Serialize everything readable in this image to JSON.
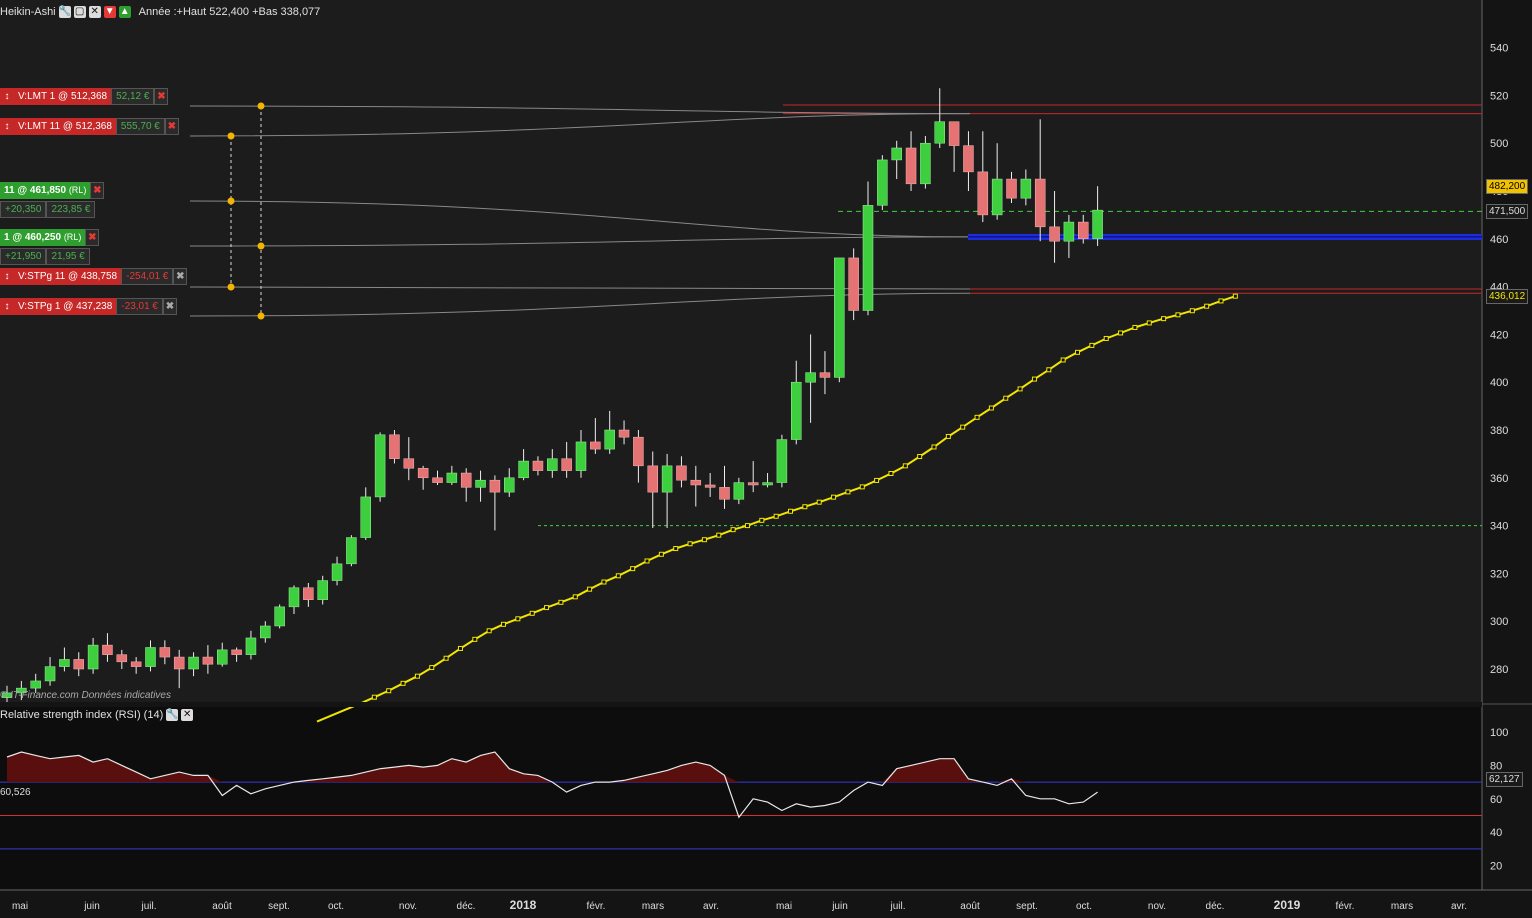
{
  "header": {
    "title": "Heikin-Ashi",
    "info": "Année :+Haut 522,400 +Bas 338,077",
    "copyright_prefix": "© IT-Finance.com",
    "copyright_suffix": "Données indicatives"
  },
  "rsi_header": {
    "title": "Relative strength index (RSI) (14)",
    "left_value": "60,526"
  },
  "orders": [
    {
      "label": "V:LMT  1 @ 512,368",
      "pnl": "52,12 €",
      "pnl_sign": "pos",
      "type": "red",
      "price": 515.5
    },
    {
      "label": "V:LMT  11 @ 512,368",
      "pnl": "555,70 €",
      "pnl_sign": "pos",
      "type": "red",
      "price": 503.5
    },
    {
      "label": "11 @ 461,850",
      "tag": "(RL)",
      "sub1": "+20,350",
      "sub2": "223,85 €",
      "type": "green",
      "price": 476
    },
    {
      "label": "1 @ 460,250",
      "tag": "(RL)",
      "sub1": "+21,950",
      "sub2": "21,95 €",
      "type": "green",
      "price": 456.5
    },
    {
      "label": "V:STPg  11 @ 438,758",
      "pnl": "-254,01 €",
      "pnl_sign": "neg",
      "type": "red",
      "price": 439.5
    },
    {
      "label": "V:STPg  1 @ 437,238",
      "pnl": "-23,01 €",
      "pnl_sign": "neg",
      "type": "red",
      "price": 429
    }
  ],
  "price_tags": [
    {
      "value": "482,200",
      "price": 482.2,
      "bg": "#f2c200",
      "fg": "#000"
    },
    {
      "value": "471,500",
      "price": 471.5,
      "bg": "#1a1a1a",
      "fg": "#ddd"
    },
    {
      "value": "436,012",
      "price": 436.0,
      "bg": "#1a1a1a",
      "fg": "#f2e600"
    }
  ],
  "rsi_tag": {
    "value": "62,127"
  },
  "colors": {
    "up": "#3ecf3e",
    "down": "#e57373",
    "ma": "#f2e600",
    "bg": "#1a1a1a",
    "grid_text": "#dddddd"
  },
  "chart_data": {
    "type": "candlestick",
    "title": "Heikin-Ashi",
    "y_axis": {
      "ticks": [
        280,
        300,
        320,
        340,
        360,
        380,
        400,
        420,
        440,
        460,
        480,
        500,
        520,
        540
      ]
    },
    "x_axis": {
      "ticks": [
        "mai",
        "juin",
        "juil.",
        "août",
        "sept.",
        "oct.",
        "nov.",
        "déc.",
        "2018",
        "févr.",
        "mars",
        "avr.",
        "mai",
        "juin",
        "juil.",
        "août",
        "sept.",
        "oct.",
        "nov.",
        "déc.",
        "2019",
        "févr.",
        "mars",
        "avr."
      ]
    },
    "candles": [
      [
        268,
        270,
        265,
        273
      ],
      [
        270,
        272,
        267,
        275
      ],
      [
        272,
        275,
        270,
        278
      ],
      [
        275,
        281,
        273,
        285
      ],
      [
        281,
        284,
        279,
        289
      ],
      [
        284,
        280,
        277,
        287
      ],
      [
        280,
        290,
        278,
        293
      ],
      [
        290,
        286,
        283,
        295
      ],
      [
        286,
        283,
        280,
        288
      ],
      [
        283,
        281,
        278,
        285
      ],
      [
        281,
        289,
        279,
        292
      ],
      [
        289,
        285,
        282,
        292
      ],
      [
        285,
        280,
        272,
        288
      ],
      [
        280,
        285,
        277,
        287
      ],
      [
        285,
        282,
        278,
        290
      ],
      [
        282,
        288,
        281,
        291
      ],
      [
        288,
        286,
        283,
        289
      ],
      [
        286,
        293,
        284,
        296
      ],
      [
        293,
        298,
        291,
        300
      ],
      [
        298,
        306,
        297,
        307
      ],
      [
        306,
        314,
        303,
        315
      ],
      [
        314,
        309,
        306,
        316
      ],
      [
        309,
        317,
        307,
        319
      ],
      [
        317,
        324,
        315,
        327
      ],
      [
        324,
        335,
        323,
        336
      ],
      [
        335,
        352,
        334,
        356
      ],
      [
        352,
        378,
        350,
        379
      ],
      [
        378,
        368,
        366,
        380
      ],
      [
        368,
        364,
        359,
        377
      ],
      [
        364,
        360,
        355,
        365
      ],
      [
        360,
        358,
        357,
        363
      ],
      [
        358,
        362,
        357,
        365
      ],
      [
        362,
        356,
        350,
        364
      ],
      [
        356,
        359,
        350,
        363
      ],
      [
        359,
        354,
        338,
        361
      ],
      [
        354,
        360,
        352,
        364
      ],
      [
        360,
        367,
        359,
        372
      ],
      [
        367,
        363,
        361,
        369
      ],
      [
        363,
        368,
        360,
        372
      ],
      [
        368,
        363,
        360,
        375
      ],
      [
        363,
        375,
        360,
        380
      ],
      [
        375,
        372,
        370,
        385
      ],
      [
        372,
        380,
        370,
        388
      ],
      [
        380,
        377,
        374,
        384
      ],
      [
        377,
        365,
        358,
        380
      ],
      [
        365,
        354,
        339,
        371
      ],
      [
        354,
        365,
        339,
        370
      ],
      [
        365,
        359,
        356,
        369
      ],
      [
        359,
        357,
        348,
        365
      ],
      [
        357,
        356,
        352,
        362
      ],
      [
        356,
        351,
        347,
        365
      ],
      [
        351,
        358,
        349,
        360
      ],
      [
        358,
        357,
        354,
        367
      ],
      [
        357,
        358,
        356,
        362
      ],
      [
        358,
        376,
        356,
        378
      ],
      [
        376,
        400,
        374,
        409
      ],
      [
        400,
        404,
        383,
        420
      ],
      [
        404,
        402,
        395,
        413
      ],
      [
        402,
        452,
        400,
        446
      ],
      [
        452,
        430,
        426,
        456
      ],
      [
        430,
        474,
        428,
        484
      ],
      [
        474,
        493,
        472,
        495
      ],
      [
        493,
        498,
        485,
        501
      ],
      [
        498,
        483,
        480,
        505
      ],
      [
        483,
        500,
        481,
        503
      ],
      [
        500,
        509,
        498,
        523
      ],
      [
        509,
        499,
        488,
        507
      ],
      [
        499,
        488,
        480,
        505
      ],
      [
        488,
        470,
        467,
        505
      ],
      [
        470,
        485,
        468,
        500
      ],
      [
        485,
        477,
        475,
        488
      ],
      [
        477,
        485,
        474,
        489
      ],
      [
        485,
        465,
        459,
        510
      ],
      [
        465,
        459,
        450,
        480
      ],
      [
        459,
        467,
        452,
        470
      ],
      [
        467,
        460,
        458,
        470
      ],
      [
        460,
        472,
        457,
        482
      ]
    ],
    "ma_points": [
      [
        268,
        258.0
      ],
      [
        269,
        260.5
      ],
      [
        270,
        263.0
      ],
      [
        271,
        265.5
      ],
      [
        272,
        268.2
      ],
      [
        273,
        270.9
      ],
      [
        274,
        274.0
      ],
      [
        275,
        277.0
      ],
      [
        276,
        280.6
      ],
      [
        277,
        284.5
      ],
      [
        278,
        288.6
      ],
      [
        279,
        292.4
      ],
      [
        280,
        296.0
      ],
      [
        281,
        298.7
      ],
      [
        282,
        301.0
      ],
      [
        283,
        303.3
      ],
      [
        284,
        305.7
      ],
      [
        285,
        307.9
      ],
      [
        286,
        310.2
      ],
      [
        287,
        313.4
      ],
      [
        288,
        316.4
      ],
      [
        289,
        319.0
      ],
      [
        290,
        322.0
      ],
      [
        291,
        325.2
      ],
      [
        292,
        328.0
      ],
      [
        293,
        330.4
      ],
      [
        294,
        332.4
      ],
      [
        295,
        334.1
      ],
      [
        296,
        336.0
      ],
      [
        297,
        338.3
      ],
      [
        298,
        340.0
      ],
      [
        299,
        342.2
      ],
      [
        300,
        343.9
      ],
      [
        301,
        346.0
      ],
      [
        302,
        347.9
      ],
      [
        303,
        349.8
      ],
      [
        304,
        351.9
      ],
      [
        305,
        354.1
      ],
      [
        306,
        356.2
      ],
      [
        307,
        358.9
      ],
      [
        308,
        361.8
      ],
      [
        309,
        365.0
      ],
      [
        310,
        368.9
      ],
      [
        311,
        372.9
      ],
      [
        312,
        377.3
      ],
      [
        313,
        381.2
      ],
      [
        314,
        385.3
      ],
      [
        315,
        389.2
      ],
      [
        316,
        393.3
      ],
      [
        317,
        397.2
      ],
      [
        318,
        401.3
      ],
      [
        319,
        405.2
      ],
      [
        320,
        409.3
      ],
      [
        321,
        412.5
      ],
      [
        322,
        415.4
      ],
      [
        323,
        418.3
      ],
      [
        324,
        420.6
      ],
      [
        325,
        422.9
      ],
      [
        326,
        424.8
      ],
      [
        327,
        426.6
      ],
      [
        328,
        428.2
      ],
      [
        329,
        429.9
      ],
      [
        330,
        431.8
      ],
      [
        331,
        434.0
      ],
      [
        332,
        436.0
      ]
    ],
    "rsi": {
      "levels": [
        70,
        50,
        30
      ],
      "y_ticks": [
        20,
        40,
        60,
        80,
        100
      ],
      "values": [
        85,
        88,
        86,
        84,
        85,
        86,
        82,
        84,
        80,
        76,
        72,
        74,
        76,
        74,
        74,
        62,
        68,
        63,
        66,
        68,
        70,
        71,
        72,
        73,
        74,
        76,
        78,
        79,
        80,
        79,
        80,
        84,
        82,
        86,
        88,
        78,
        75,
        74,
        70,
        64,
        68,
        70,
        70,
        71,
        73,
        75,
        77,
        80,
        82,
        80,
        74,
        49,
        60,
        58,
        53,
        57,
        55,
        56,
        58,
        65,
        70,
        68,
        78,
        80,
        82,
        84,
        84,
        72,
        70,
        68,
        72,
        62,
        60,
        60,
        57,
        58,
        64
      ]
    }
  }
}
